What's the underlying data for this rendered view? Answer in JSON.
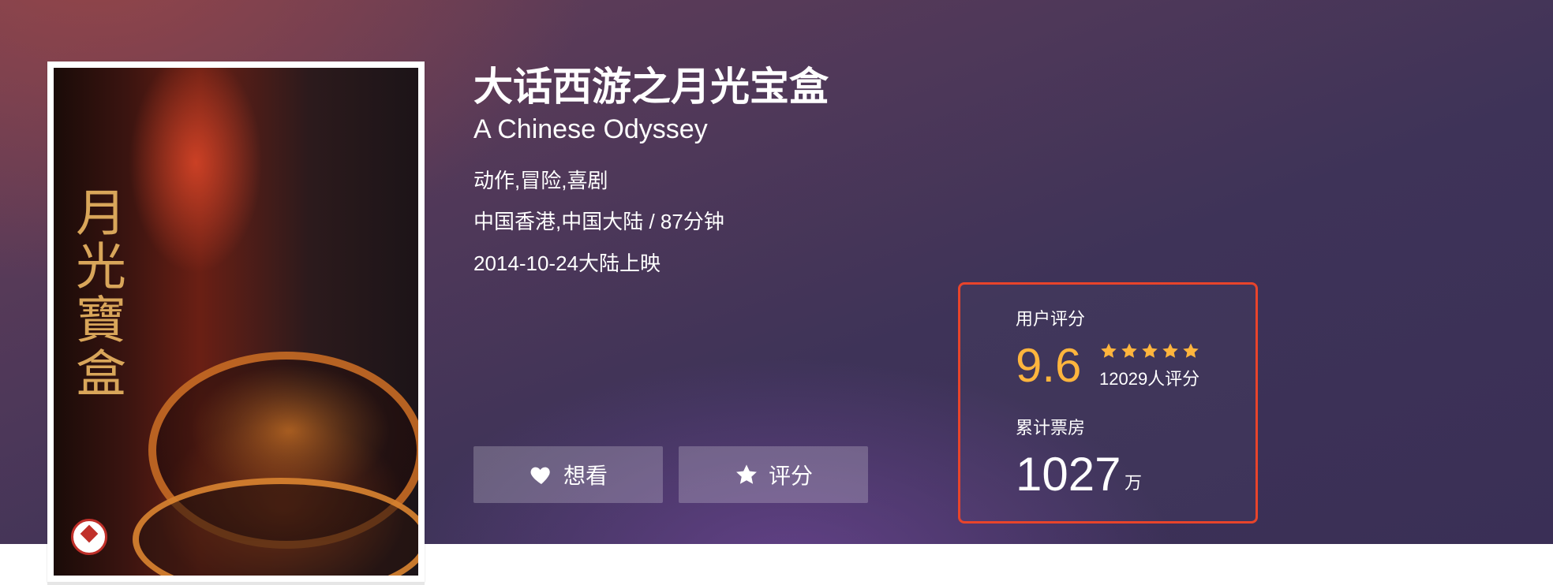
{
  "movie": {
    "title_cn": "大话西游之月光宝盒",
    "title_en": "A Chinese Odyssey",
    "genres": "动作,冒险,喜剧",
    "region_duration": "中国香港,中国大陆 / 87分钟",
    "release": "2014-10-24大陆上映"
  },
  "poster": {
    "calligraphy": "月光寶盒",
    "sponsor_logo": "CALTEX"
  },
  "actions": {
    "want_label": "想看",
    "want_icon": "heart-icon",
    "rate_label": "评分",
    "rate_icon": "star-icon"
  },
  "stats": {
    "rating_label": "用户评分",
    "score": "9.6",
    "stars_filled": 5,
    "stars_total": 5,
    "rating_count": "12029人评分",
    "box_office_label": "累计票房",
    "box_office_value": "1027",
    "box_office_unit": "万"
  },
  "colors": {
    "score": "#ffb53d",
    "highlight_border": "#e8442b",
    "star": "#ffb53d"
  }
}
